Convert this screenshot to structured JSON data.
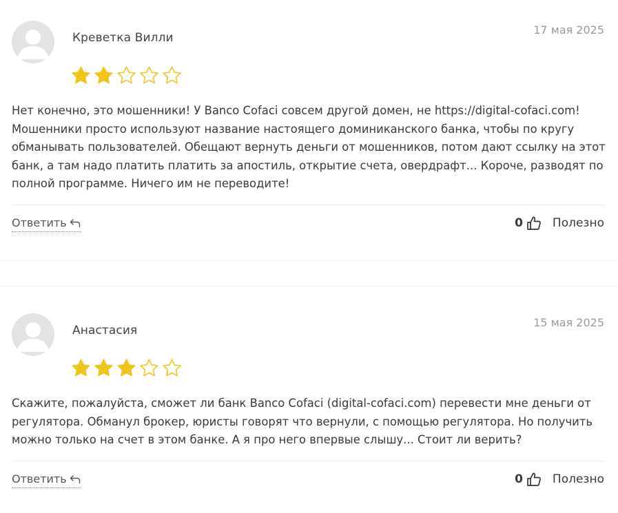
{
  "reviews": [
    {
      "author": "Креветка Вилли",
      "date": "17 мая 2025",
      "rating": 2,
      "rating_max": 5,
      "text": "Нет конечно, это мошенники! У Banco Cofaci совсем другой домен, не https://digital-cofaci.com! Мошенники просто используют название настоящего доминиканского банка, чтобы по кругу обманывать пользователей. Обещают вернуть деньги от мошенников, потом дают ссылку на этот банк, а там надо платить платить за апостиль, открытие счета, овердрафт... Короче, разводят по полной программе. Ничего им не переводите!",
      "reply_label": "Ответить",
      "helpful_count": "0",
      "helpful_label": "Полезно"
    },
    {
      "author": "Анастасия",
      "date": "15 мая 2025",
      "rating": 3,
      "rating_max": 5,
      "text": "Скажите, пожалуйста, сможет ли банк Banco Cofaci (digital-cofaci.com) перевести мне деньги от регулятора. Обманул брокер, юристы говорят что вернули, с помощью регулятора. Но получить можно только на счет в этом банке. А я про него впервые слышу... Стоит ли верить?",
      "reply_label": "Ответить",
      "helpful_count": "0",
      "helpful_label": "Полезно"
    }
  ],
  "colors": {
    "star_filled": "#F0C419",
    "star_outline": "#F0C419",
    "avatar_bg": "#E3E3E3",
    "avatar_fg": "#FFFFFF",
    "date": "#9A9A9A",
    "divider": "#EBEBEB"
  },
  "icons": {
    "avatar": "user-silhouette-icon",
    "star": "star-icon",
    "reply": "reply-arrow-icon",
    "helpful": "thumbs-up-icon"
  }
}
